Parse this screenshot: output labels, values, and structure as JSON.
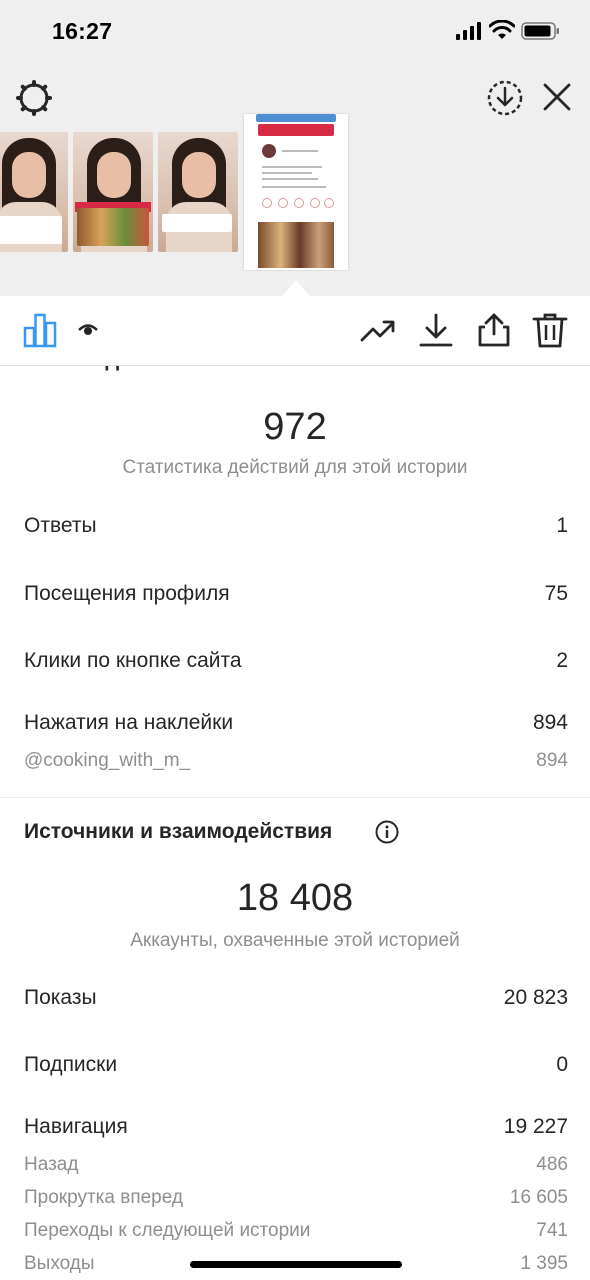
{
  "status_bar": {
    "time": "16:27"
  },
  "stories": {
    "active_thumb": {
      "header": "Как найти рецепт пудинга?",
      "tag": "@cooking_with_m_"
    }
  },
  "toolbar": {
    "icons": [
      "bar-chart-icon",
      "eye-icon",
      "trending-icon",
      "download-icon",
      "share-icon",
      "trash-icon"
    ]
  },
  "interactions": {
    "title": "Взаимодействия",
    "total": "972",
    "caption": "Статистика действий для этой истории",
    "rows": [
      {
        "label": "Ответы",
        "value": "1"
      },
      {
        "label": "Посещения профиля",
        "value": "75"
      },
      {
        "label": "Клики по кнопке сайта",
        "value": "2"
      },
      {
        "label": "Нажатия на наклейки",
        "value": "894"
      }
    ],
    "sticker": {
      "label": "@cooking_with_m_",
      "value": "894"
    }
  },
  "discovery": {
    "title": "Источники и взаимодействия",
    "total": "18 408",
    "caption": "Аккаунты, охваченные этой историей",
    "rows": [
      {
        "label": "Показы",
        "value": "20 823"
      },
      {
        "label": "Подписки",
        "value": "0"
      },
      {
        "label": "Навигация",
        "value": "19 227"
      }
    ],
    "navigation": [
      {
        "label": "Назад",
        "value": "486"
      },
      {
        "label": "Прокрутка вперед",
        "value": "16 605"
      },
      {
        "label": "Переходы к следующей истории",
        "value": "741"
      },
      {
        "label": "Выходы",
        "value": "1 395"
      }
    ]
  },
  "colors": {
    "accent": "#3897f0",
    "tag_red": "#d92a45",
    "text": "#262626",
    "muted": "#8e8e8e"
  }
}
